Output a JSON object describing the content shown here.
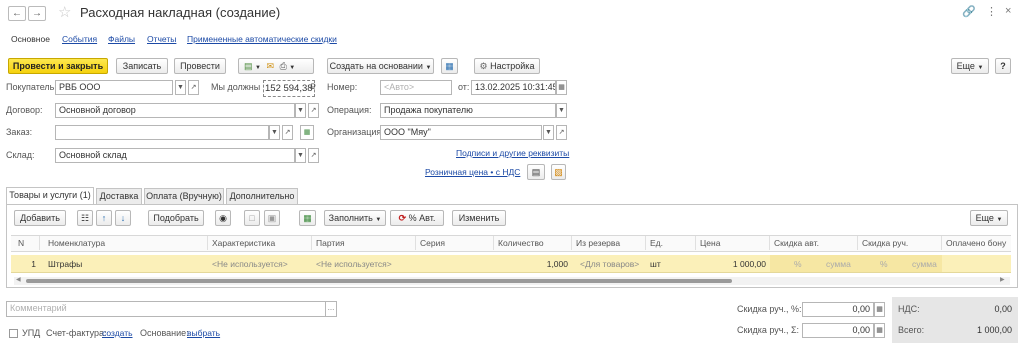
{
  "window": {
    "title": "Расходная накладная (создание)"
  },
  "nav": {
    "items": [
      "Основное",
      "События",
      "Файлы",
      "Отчеты",
      "Примененные автоматические скидки"
    ]
  },
  "toolbar": {
    "post_close": "Провести и закрыть",
    "save": "Записать",
    "post": "Провести",
    "create_based": "Создать на основании",
    "settings": "Настройка",
    "more": "Еще",
    "help": "?"
  },
  "header": {
    "buyer_label": "Покупатель:",
    "buyer_value": "РВБ ООО",
    "owe_label": "Мы должны",
    "owe_value": "152 594,38",
    "owe_currency": "₽",
    "number_label": "Номер:",
    "number_placeholder": "<Авто>",
    "from_label": "от:",
    "date_value": "13.02.2025 10:31:45",
    "contract_label": "Договор:",
    "contract_value": "Основной договор",
    "operation_label": "Операция:",
    "operation_value": "Продажа покупателю",
    "order_label": "Заказ:",
    "order_value": "",
    "org_label": "Организация:",
    "org_value": "ООО \"Мяу\"",
    "warehouse_label": "Склад:",
    "warehouse_value": "Основной склад",
    "signatures_link": "Подписи и другие реквизиты",
    "retail_price_link": "Розничная цена • с НДС"
  },
  "tabs": [
    "Товары и услуги (1)",
    "Доставка",
    "Оплата (Вручную)",
    "Дополнительно"
  ],
  "table_toolbar": {
    "add": "Добавить",
    "pick": "Подобрать",
    "fill": "Заполнить",
    "auto_percent": "% Авт.",
    "change": "Изменить",
    "more": "Еще"
  },
  "table": {
    "columns": [
      "N",
      "Номенклатура",
      "Характеристика",
      "Партия",
      "Серия",
      "Количество",
      "Из резерва",
      "Ед.",
      "Цена",
      "Скидка авт.",
      "Скидка руч.",
      "Оплачено бону"
    ],
    "rows": [
      {
        "n": "1",
        "item": "Штрафы",
        "characteristic": "<Не используется>",
        "batch": "<Не используется>",
        "series": "",
        "quantity": "1,000",
        "reserve": "<Для товаров>",
        "unit": "шт",
        "price": "1 000,00",
        "auto_pct": "%",
        "auto_sum": "сумма",
        "manual_pct": "%",
        "manual_sum": "сумма"
      }
    ]
  },
  "footer": {
    "comment_placeholder": "Комментарий",
    "upd_label": "УПД",
    "invoice_label": "Счет-фактура:",
    "invoice_link": "создать",
    "basis_label": "Основание:",
    "basis_link": "выбрать",
    "manual_pct_label": "Скидка руч., %:",
    "manual_pct_value": "0,00",
    "manual_sum_label": "Скидка руч., Σ:",
    "manual_sum_value": "0,00",
    "vat_label": "НДС:",
    "vat_value": "0,00",
    "total_label": "Всего:",
    "total_value": "1 000,00"
  }
}
